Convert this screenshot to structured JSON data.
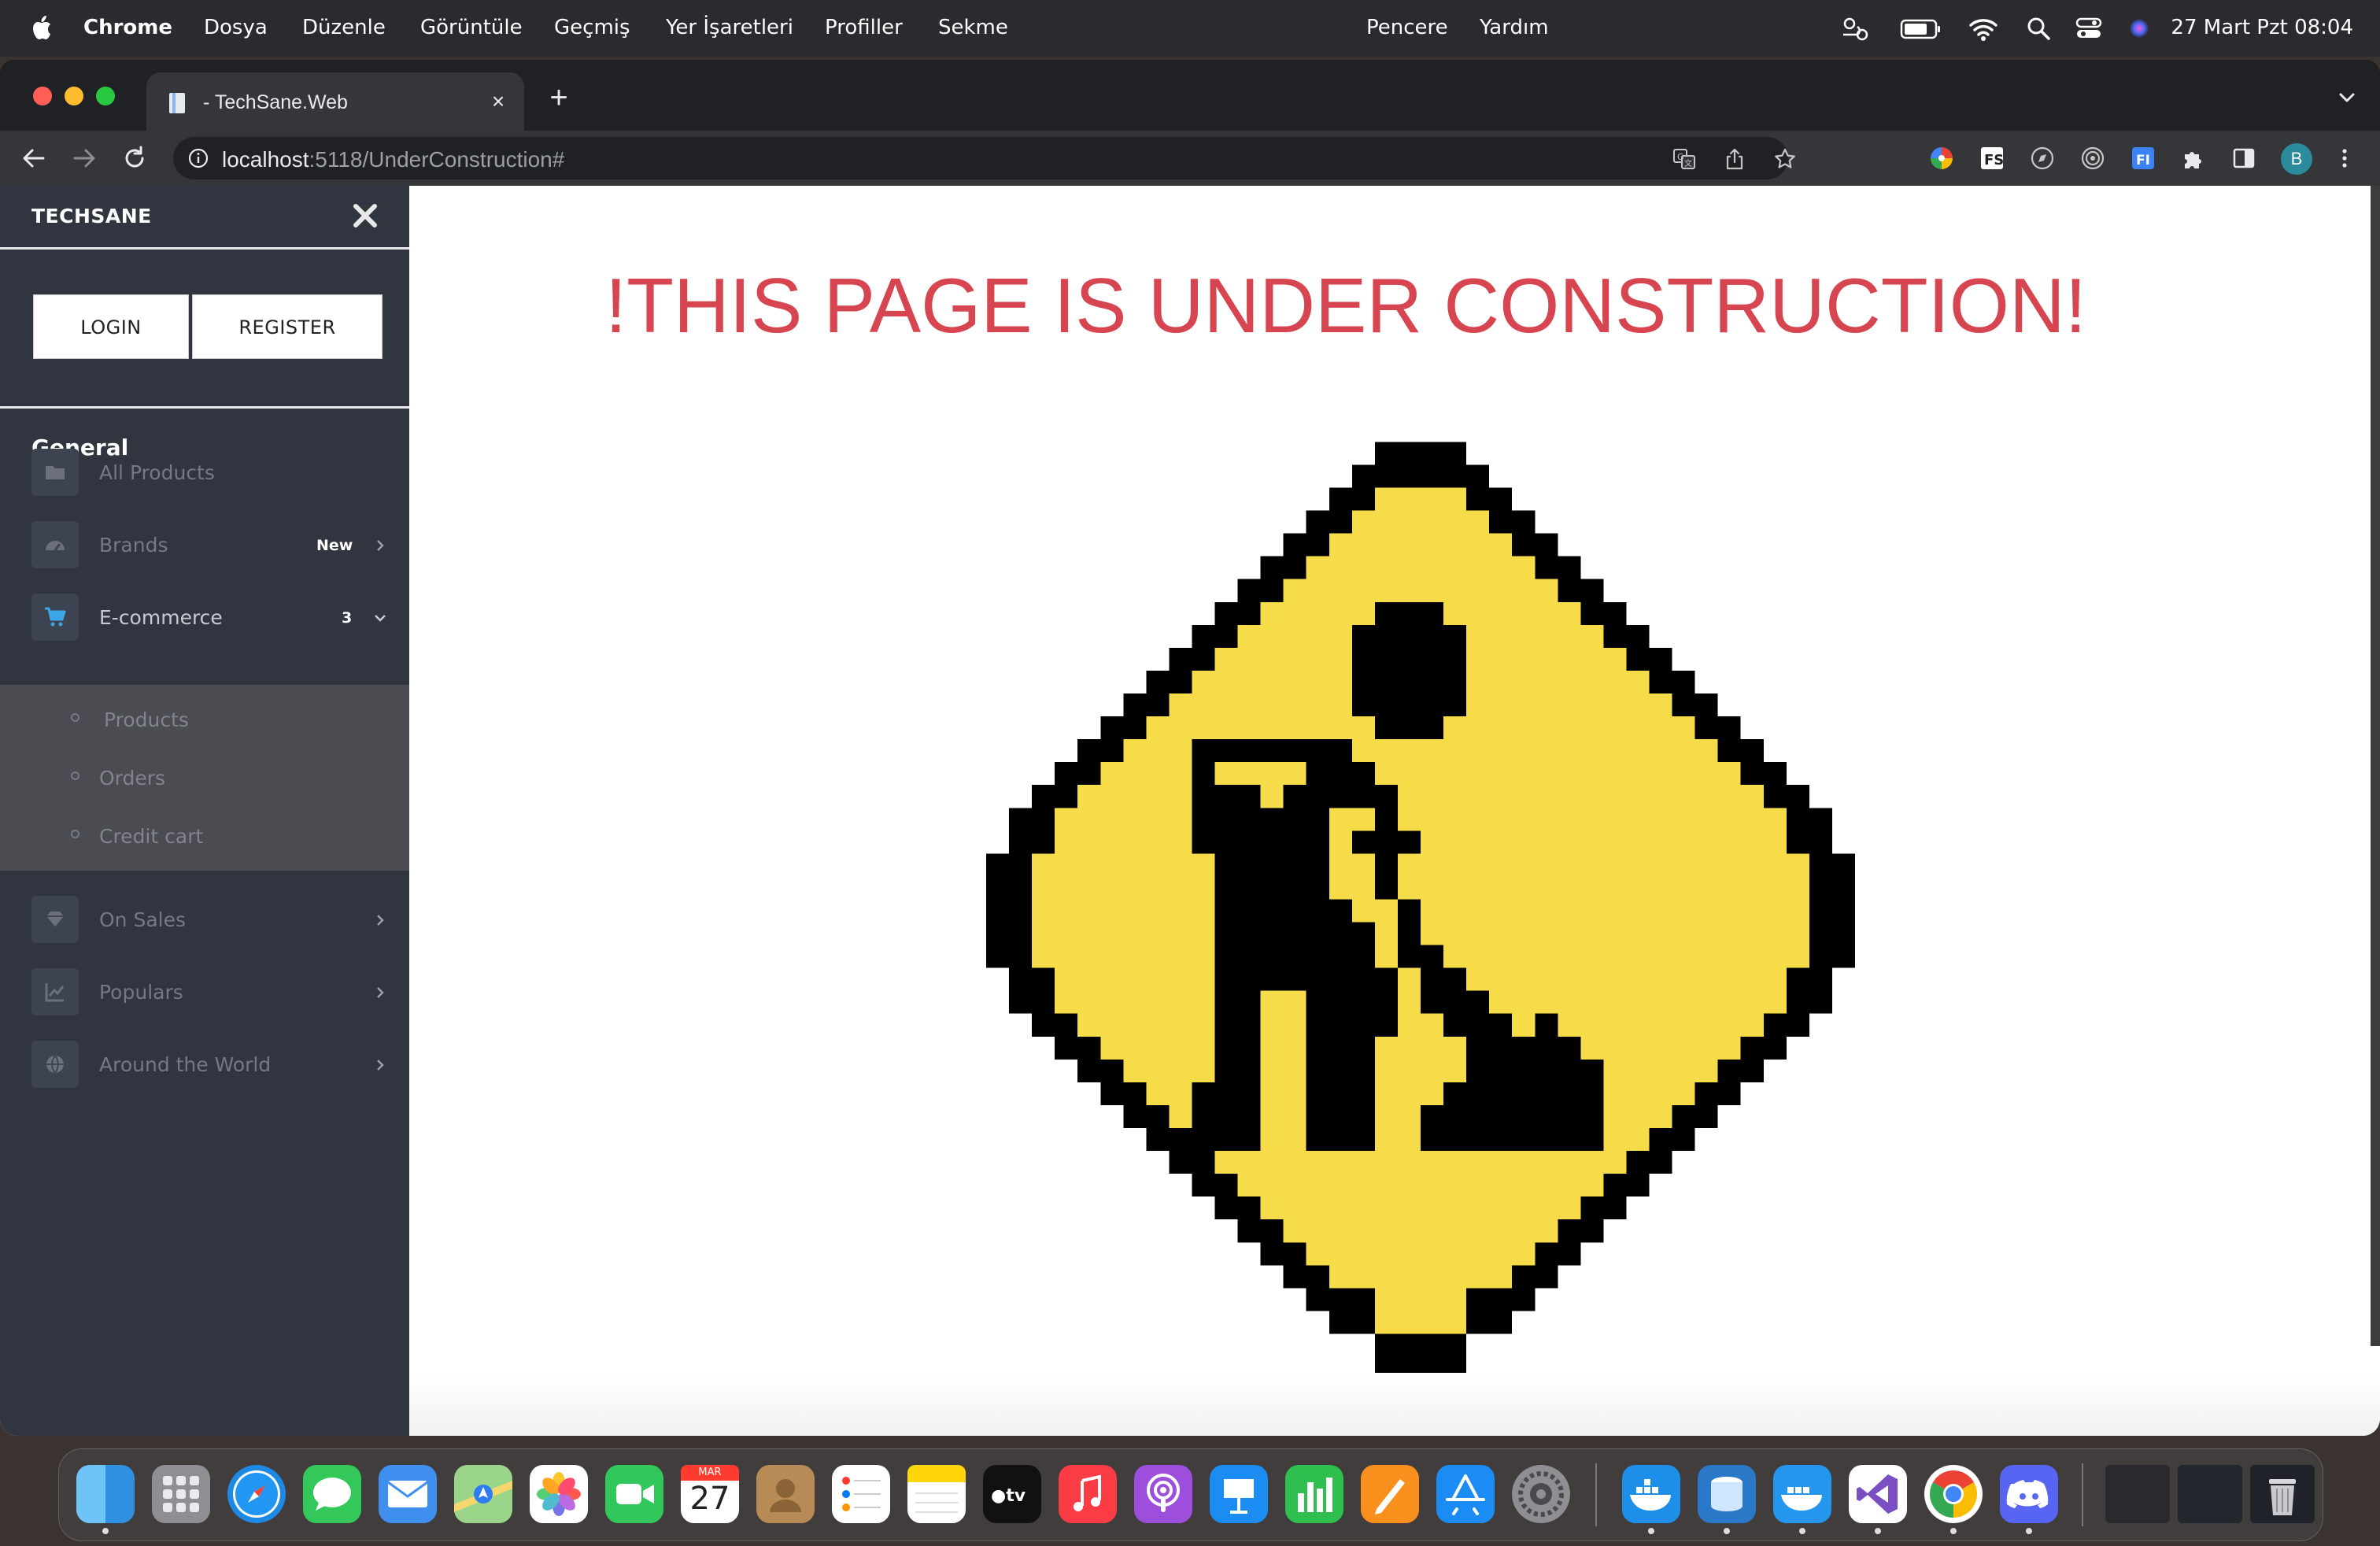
{
  "menubar": {
    "apple": "apple-icon",
    "app_name": "Chrome",
    "menus": [
      "Dosya",
      "Düzenle",
      "Görüntüle",
      "Geçmiş",
      "Yer İşaretleri",
      "Profiller",
      "Sekme",
      "Pencere",
      "Yardım"
    ],
    "clock": "27 Mart Pzt  08:04",
    "status_icons": [
      "weather-icon",
      "battery-icon",
      "wifi-icon",
      "spotlight-icon",
      "control-center-icon",
      "siri-icon"
    ]
  },
  "browser": {
    "tab": {
      "title": "- TechSane.Web",
      "close": "×"
    },
    "new_tab": "+",
    "url_host": "localhost",
    "url_path": ":5118/UnderConstruction#",
    "toolbar_icons": [
      "translate-icon",
      "share-icon",
      "bookmark-star-icon"
    ],
    "extensions": [
      "color-picker-extension-icon",
      "fs-extension-icon",
      "compass-extension-icon",
      "target-extension-icon",
      "fi-extension-icon",
      "puzzle-extensions-icon",
      "sidepanel-icon"
    ],
    "profile_initial": "B",
    "colors": {
      "frame": "#202124",
      "toolbar": "#35363a",
      "avatar": "#2b8a9b"
    }
  },
  "sidebar": {
    "brand": "TECHSANE",
    "login": "LOGIN",
    "register": "REGISTER",
    "section": "General",
    "items": [
      {
        "label": "All Products",
        "icon": "folder-icon"
      },
      {
        "label": "Brands",
        "icon": "gauge-icon",
        "badge": "New"
      },
      {
        "label": "E-commerce",
        "icon": "cart-icon",
        "badge": "3",
        "expanded": true
      },
      {
        "label": "On Sales",
        "icon": "diamond-icon"
      },
      {
        "label": "Populars",
        "icon": "chart-icon"
      },
      {
        "label": "Around the World",
        "icon": "globe-icon"
      }
    ],
    "subitems": [
      "Products",
      "Orders",
      "Credit cart"
    ],
    "colors": {
      "bg": "#30353f",
      "submenu_bg": "#4a4c51",
      "cart_icon": "#3aa8e8"
    }
  },
  "main": {
    "headline": "!THIS PAGE IS UNDER CONSTRUCTION!",
    "sign": "under-construction-worker-sign",
    "colors": {
      "headline": "#d64550",
      "sign_yellow": "#f7dc4a"
    }
  },
  "dock": {
    "apps": [
      "Finder",
      "Launchpad",
      "Safari",
      "Messages",
      "Mail",
      "Maps",
      "Photos",
      "FaceTime",
      "Calendar",
      "Contacts",
      "Reminders",
      "Notes",
      "TV",
      "Music",
      "Podcasts",
      "Keynote",
      "Numbers",
      "Pages",
      "App Store",
      "System Settings",
      "Docker",
      "Azure Data Studio",
      "Docker Desktop",
      "Visual Studio",
      "Google Chrome",
      "Discord"
    ],
    "calendar": {
      "month": "MAR",
      "day": "27"
    }
  }
}
